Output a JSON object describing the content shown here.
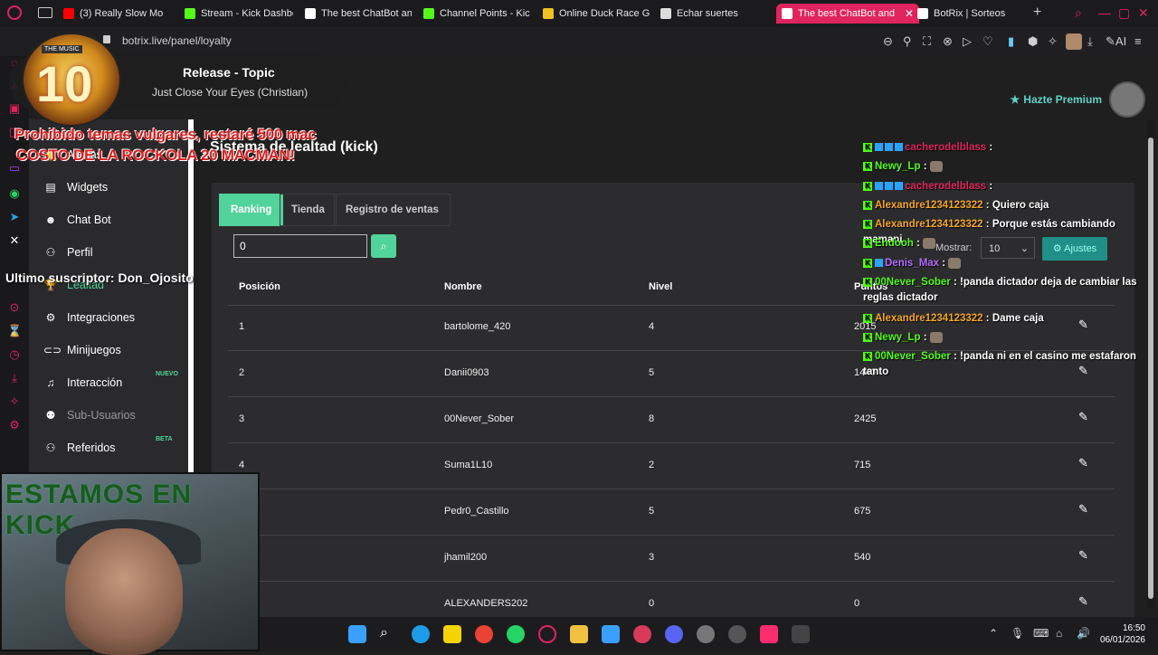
{
  "browser": {
    "tabs": [
      {
        "label": "(3) Really Slow Mo",
        "color": "#ff0000"
      },
      {
        "label": "Stream - Kick Dashbo",
        "color": "#53fc18"
      },
      {
        "label": "The best ChatBot and",
        "color": "#ffffff"
      },
      {
        "label": "Channel Points - Kick",
        "color": "#53fc18"
      },
      {
        "label": "Online Duck Race Ga",
        "color": "#f0c020"
      },
      {
        "label": "Echar suertes",
        "color": "#dddddd"
      },
      {
        "label": "The best ChatBot and",
        "color": "#ffffff",
        "active": true
      },
      {
        "label": "BotRix | Sorteos",
        "color": "#ffffff"
      }
    ],
    "url": "botrix.live/panel/loyalty"
  },
  "header": {
    "premium_label": "Hazte Premium"
  },
  "music_widget": {
    "title": "Release - Topic",
    "subtitle": "Just Close Your Eyes (Christian)",
    "logo_tag": "THE MUSIC",
    "logo_number": "10"
  },
  "overlay": {
    "rules_line1": "Prohibido temas vulgares, restaré 500 mac",
    "rules_line2": "COSTO DE LA ROCKOLA 20 MACMAN!",
    "last_sub": "Ultimo suscriptor: Don_Ojosito",
    "cam_text": "ESTAMOS EN KICK"
  },
  "sidebar": {
    "items": [
      {
        "label": "Alertas",
        "icon": "bell-icon"
      },
      {
        "label": "Widgets",
        "icon": "widgets-icon"
      },
      {
        "label": "Chat Bot",
        "icon": "robot-icon"
      },
      {
        "label": "Perfil",
        "icon": "user-icon"
      },
      {
        "label": "Lealtad",
        "icon": "trophy-icon",
        "active": true
      },
      {
        "label": "Integraciones",
        "icon": "integrations-icon"
      },
      {
        "label": "Minijuegos",
        "icon": "gamepad-icon"
      },
      {
        "label": "Interacción",
        "icon": "music-icon",
        "badge": "NUEVO"
      },
      {
        "label": "Sub-Usuarios",
        "icon": "users-icon",
        "muted": true
      },
      {
        "label": "Referidos",
        "icon": "referrals-icon",
        "badge": "BETA"
      }
    ]
  },
  "main": {
    "title": "Sistema de lealtad (kick)",
    "tabs": [
      "Ranking",
      "Tienda",
      "Registro de ventas"
    ],
    "search_value": "0",
    "show_label": "Mostrar:",
    "show_value": "10",
    "settings_label": "Ajustes",
    "table": {
      "headers": [
        "Posición",
        "Nombre",
        "Nivel",
        "Puntos"
      ],
      "rows": [
        [
          "1",
          "bartolome_420",
          "4",
          "2015"
        ],
        [
          "2",
          "Danii0903",
          "5",
          "1440"
        ],
        [
          "3",
          "00Never_Sober",
          "8",
          "2425"
        ],
        [
          "4",
          "Suma1L10",
          "2",
          "715"
        ],
        [
          "5",
          "Pedr0_Castillo",
          "5",
          "675"
        ],
        [
          "6",
          "jhamil200",
          "3",
          "540"
        ],
        [
          "7",
          "ALEXANDERS202",
          "0",
          "0"
        ]
      ]
    }
  },
  "chat": [
    {
      "user": "cacherodelblass",
      "color": "#e0245e",
      "msg": "",
      "badges": 3
    },
    {
      "user": "Newy_Lp",
      "color": "#53fc18",
      "msg": "",
      "badges": 0,
      "emote": true
    },
    {
      "user": "cacherodelblass",
      "color": "#e0245e",
      "msg": "",
      "badges": 3
    },
    {
      "user": "Alexandre1234123322",
      "color": "#f5a623",
      "msg": "Quiero caja",
      "badges": 0
    },
    {
      "user": "Alexandre1234123322",
      "color": "#f5a623",
      "msg": "Porque estás cambiando mamani",
      "badges": 0
    },
    {
      "user": "Endooh",
      "color": "#53fc18",
      "msg": "",
      "badges": 0,
      "emote": true
    },
    {
      "user": "Denis_Max",
      "color": "#b36bff",
      "msg": "",
      "badges": 1,
      "emote": true
    },
    {
      "user": "00Never_Sober",
      "color": "#53fc18",
      "msg": "!panda dictador deja de cambiar las reglas dictador",
      "badges": 0
    },
    {
      "user": "Alexandre1234123322",
      "color": "#f5a623",
      "msg": "Dame caja",
      "badges": 0
    },
    {
      "user": "Newy_Lp",
      "color": "#53fc18",
      "msg": "",
      "badges": 0,
      "emote": true
    },
    {
      "user": "00Never_Sober",
      "color": "#53fc18",
      "msg": "!panda ni en el casino me estafaron tanto",
      "badges": 0
    }
  ],
  "taskbar": {
    "time": "16:50",
    "date": "06/01/2026"
  },
  "colors": {
    "accent": "#52d39b",
    "opera_red": "#e0245e",
    "premium": "#5fd3c8"
  }
}
